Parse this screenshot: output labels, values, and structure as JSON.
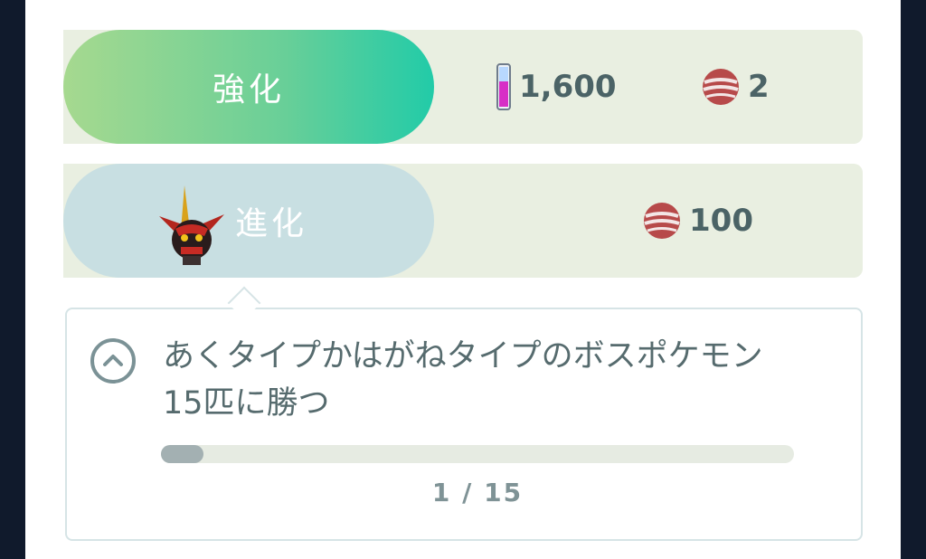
{
  "powerup": {
    "label": "強化",
    "stardust_cost": "1,600",
    "candy_cost": "2",
    "stardust_icon": "stardust-vial-icon",
    "candy_icon": "candy-icon"
  },
  "evolve": {
    "label": "進化",
    "candy_cost": "100",
    "candy_icon": "candy-icon",
    "pokemon_icon": "evolved-pokemon-sprite"
  },
  "requirement": {
    "text": "あくタイプかはがねタイプのボスポケモン15匹に勝つ",
    "progress_text": "1 / 15",
    "progress_current": 1,
    "progress_total": 15,
    "toggle_icon": "chevron-up-icon"
  },
  "colors": {
    "powerup_gradient": [
      "#a6d98f",
      "#22cba8"
    ],
    "evolve_pill": "#c8dfe2",
    "row_bg": "#e9efe1",
    "text": "#4b6366"
  }
}
